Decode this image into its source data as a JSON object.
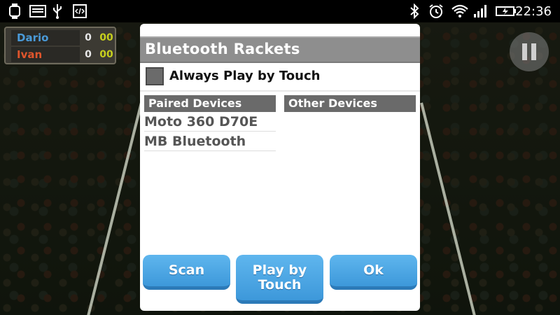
{
  "status_bar": {
    "time": "22:36",
    "left_icons": [
      "smartwatch-icon",
      "image-icon",
      "usb-icon",
      "code-icon"
    ],
    "right_icons": [
      "bluetooth-icon",
      "alarm-icon",
      "wifi-icon",
      "signal-icon",
      "battery-icon"
    ]
  },
  "scoreboard": {
    "players": [
      {
        "name": "Dario",
        "set": "0",
        "games": "00",
        "color": "#4a9ad8"
      },
      {
        "name": "Ivan",
        "set": "0",
        "games": "00",
        "color": "#e0552c"
      }
    ]
  },
  "dialog": {
    "title": "Bluetooth Rackets",
    "always_play_label": "Always Play by Touch",
    "always_play_checked": false,
    "paired_header": "Paired Devices",
    "other_header": "Other Devices",
    "paired_devices": [
      "Moto 360 D70E",
      "MB Bluetooth"
    ],
    "buttons": {
      "scan": "Scan",
      "play_by_touch": "Play by Touch",
      "ok": "Ok"
    }
  },
  "colors": {
    "button": "#4aa8e6",
    "title_bar": "#8e8e8e",
    "column_header": "#6a6a6a"
  }
}
